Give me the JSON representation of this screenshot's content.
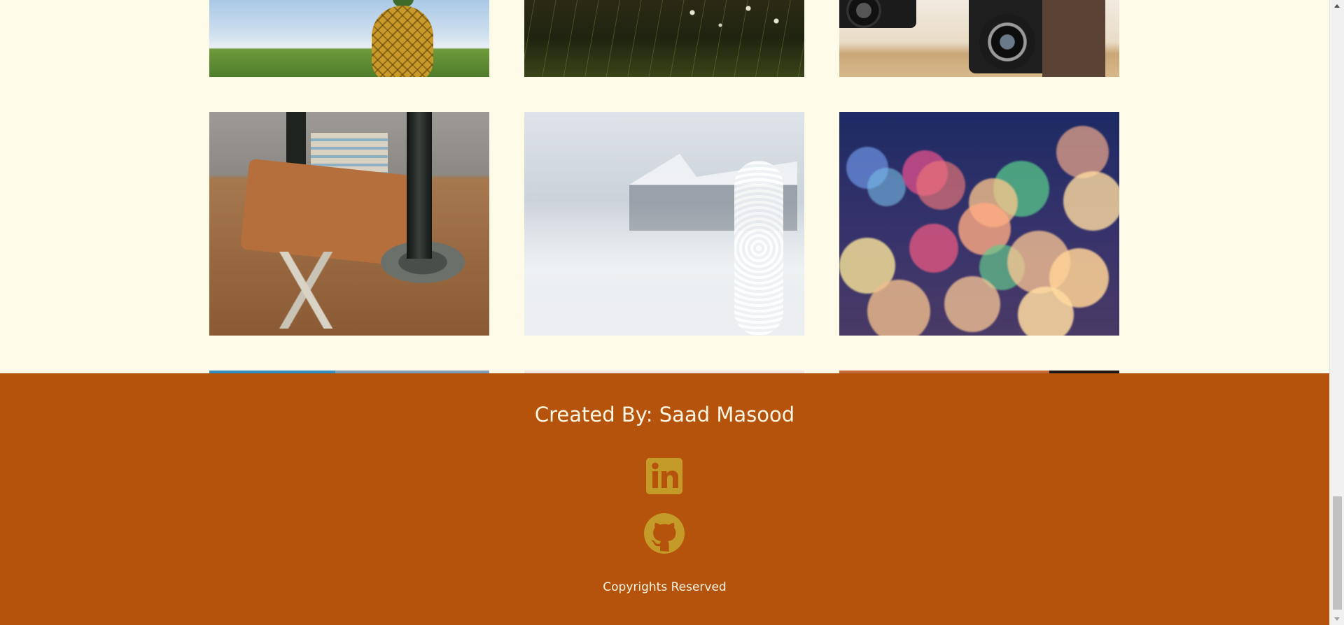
{
  "gallery": {
    "images": [
      {
        "subject": "pineapple"
      },
      {
        "subject": "dark-grass-field"
      },
      {
        "subject": "vintage-cameras"
      },
      {
        "subject": "desk-leather-compass"
      },
      {
        "subject": "frosty-winter-plants"
      },
      {
        "subject": "colorful-bokeh"
      }
    ]
  },
  "footer": {
    "title": "Created By: Saad Masood",
    "social": [
      {
        "icon": "linkedin-icon"
      },
      {
        "icon": "github-icon"
      }
    ],
    "copyright": "Copyrights Reserved",
    "background_color": "#b5520b",
    "icon_color": "#c49a28",
    "text_color": "#fdf6e3"
  },
  "page": {
    "background_color": "#fefae8"
  }
}
